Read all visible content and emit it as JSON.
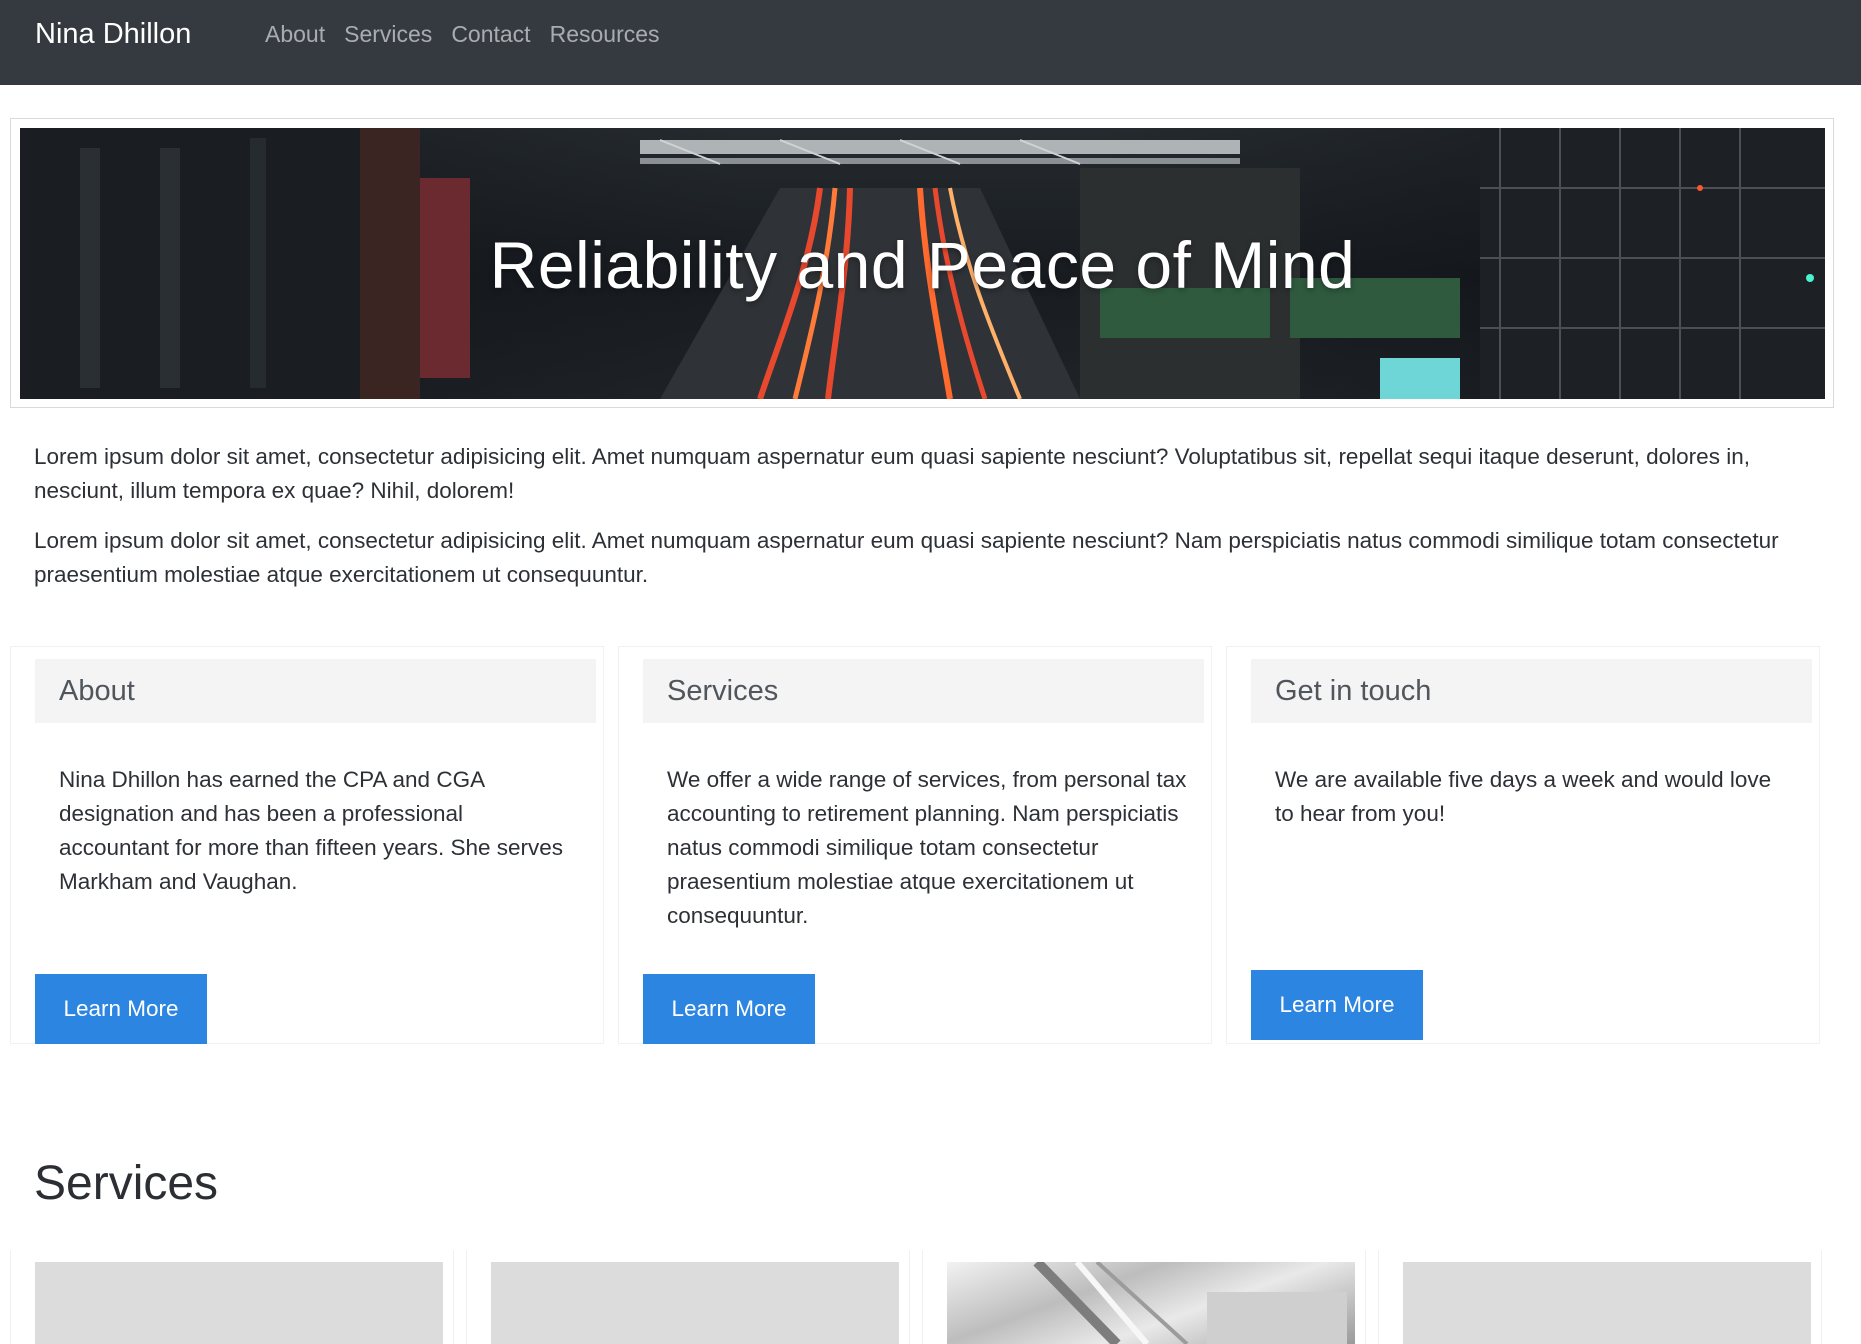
{
  "navbar": {
    "brand": "Nina Dhillon",
    "links": [
      "About",
      "Services",
      "Contact",
      "Resources"
    ]
  },
  "hero": {
    "title": "Reliability and Peace of Mind"
  },
  "intro": {
    "paragraphs": [
      "Lorem ipsum dolor sit amet, consectetur adipisicing elit. Amet numquam aspernatur eum quasi sapiente nesciunt? Voluptatibus sit, repellat sequi itaque deserunt, dolores in, nesciunt, illum tempora ex quae? Nihil, dolorem!",
      "Lorem ipsum dolor sit amet, consectetur adipisicing elit. Amet numquam aspernatur eum quasi sapiente nesciunt? Nam perspiciatis natus commodi similique totam consectetur praesentium molestiae atque exercitationem ut consequuntur."
    ]
  },
  "cards": [
    {
      "title": "About",
      "body": "Nina Dhillon has earned the CPA and CGA designation and has been a professional accountant for more than fifteen years. She serves Markham and Vaughan.",
      "button": "Learn More"
    },
    {
      "title": "Services",
      "body": "We offer a wide range of services, from personal tax accounting to retirement planning. Nam perspiciatis natus commodi similique totam consectetur praesentium molestiae atque exercitationem ut consequuntur.",
      "button": "Learn More"
    },
    {
      "title": "Get in touch",
      "body": "We are available five days a week and would love to hear from you!",
      "button": "Learn More"
    }
  ],
  "services_section": {
    "title": "Services"
  },
  "colors": {
    "navbar_bg": "#343a40",
    "button_bg": "#2c85e0",
    "card_header_bg": "#f4f4f4",
    "thumb_placeholder": "#dcdcdc"
  }
}
